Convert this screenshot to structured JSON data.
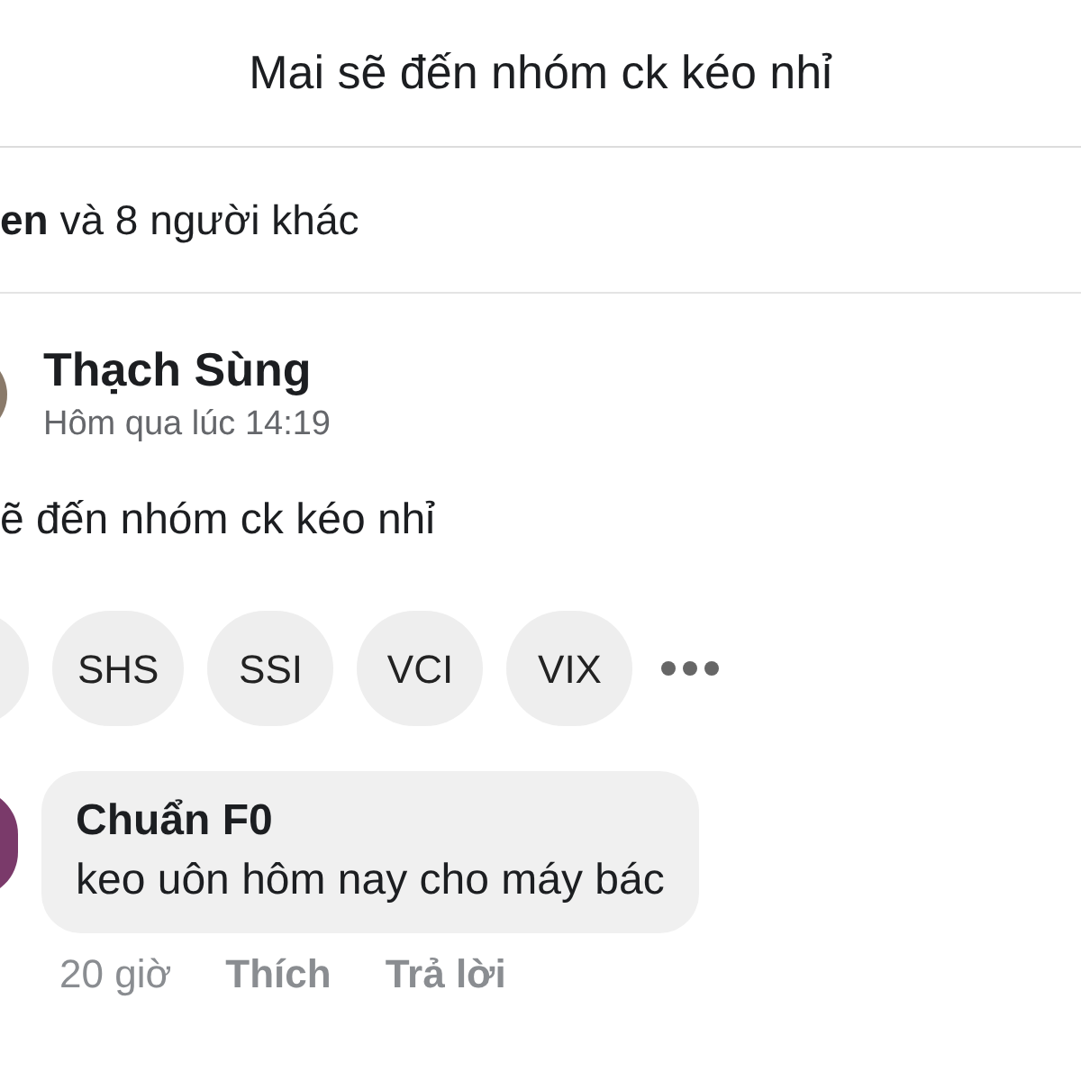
{
  "header": {
    "title": "Mai sẽ đến nhóm ck kéo nhỉ"
  },
  "reactions_summary": "**en** và 8 người khác",
  "post": {
    "author": "Thạch Sùng",
    "time": "Hôm qua lúc 14:19",
    "text": "ẽ đến nhóm ck kéo nhỉ"
  },
  "tags": [
    "SHS",
    "SSI",
    "VCI",
    "VIX"
  ],
  "comment": {
    "author": "Chuẩn F0",
    "text": "keo uôn hôm nay cho máy bác",
    "time": "20 giờ",
    "actions": [
      "Thích",
      "Trả lời"
    ]
  }
}
